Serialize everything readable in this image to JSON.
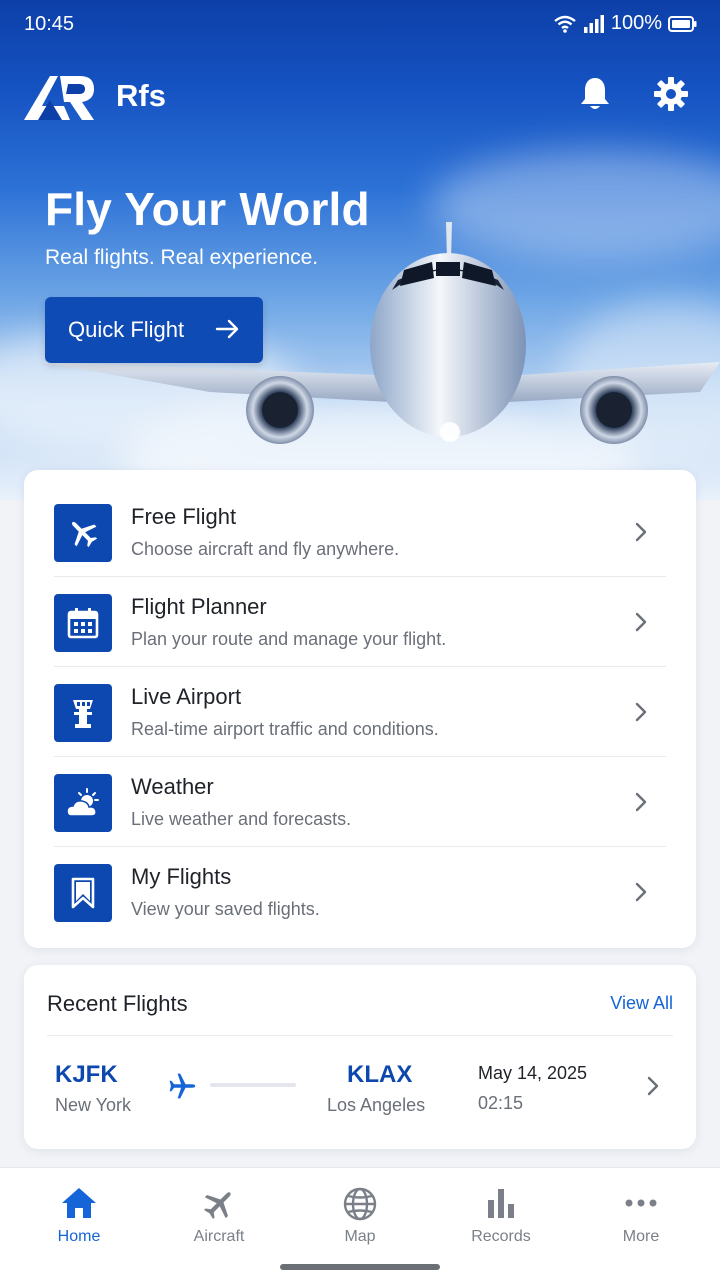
{
  "status_bar": {
    "time": "10:45",
    "battery": "100%"
  },
  "app_bar": {
    "app_name": "Rfs",
    "icons": [
      "bell-icon",
      "gear-icon"
    ]
  },
  "hero": {
    "title": "Fly Your World",
    "subtitle": "Real flights. Real experience.",
    "cta_label": "Quick Flight"
  },
  "menu": {
    "items": [
      {
        "title": "Free Flight",
        "desc": "Choose aircraft and fly anywhere.",
        "icon": "airplane-icon"
      },
      {
        "title": "Flight Planner",
        "desc": "Plan your route and manage your flight.",
        "icon": "calendar-icon"
      },
      {
        "title": "Live Airport",
        "desc": "Real-time airport traffic and conditions.",
        "icon": "control-tower-icon"
      },
      {
        "title": "Weather",
        "desc": "Live weather and forecasts.",
        "icon": "weather-icon"
      },
      {
        "title": "My Flights",
        "desc": "View your saved flights.",
        "icon": "bookmark-icon"
      }
    ]
  },
  "recent": {
    "title": "Recent Flights",
    "view_all": "View All",
    "flights": [
      {
        "from_code": "KJFK",
        "from_city": "New York",
        "to_code": "KLAX",
        "to_city": "Los Angeles",
        "date": "May 14, 2025",
        "duration": "02:15"
      }
    ]
  },
  "nav": {
    "items": [
      {
        "label": "Home",
        "icon": "home-icon",
        "active": true
      },
      {
        "label": "Aircraft",
        "icon": "airplane-icon",
        "active": false
      },
      {
        "label": "Map",
        "icon": "globe-icon",
        "active": false
      },
      {
        "label": "Records",
        "icon": "bar-chart-icon",
        "active": false
      },
      {
        "label": "More",
        "icon": "more-dots-icon",
        "active": false
      }
    ]
  },
  "colors": {
    "primary": "#0d47b0",
    "accent": "#1565d8",
    "hero_top": "#0d3fa8",
    "background": "#f1f3f7"
  }
}
